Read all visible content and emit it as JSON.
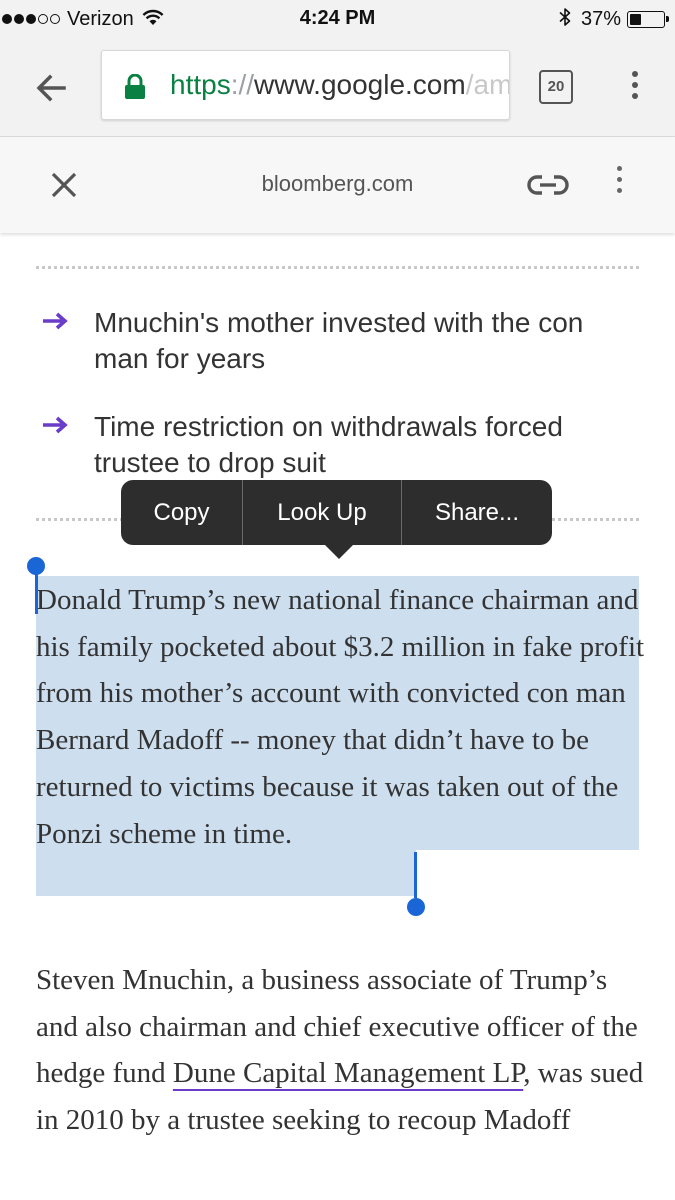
{
  "status_bar": {
    "signal_filled": 3,
    "signal_total": 5,
    "carrier": "Verizon",
    "time": "4:24 PM",
    "battery_percent": "37%",
    "battery_level": 0.37
  },
  "browser": {
    "url_scheme": "https",
    "url_separator": "://",
    "url_host": "www.google.com",
    "url_rest": "/amp",
    "tab_count": "20",
    "accent_secure": "#0b8043"
  },
  "custom_tab": {
    "domain": "bloomberg.com"
  },
  "article": {
    "bullets": [
      "Mnuchin's mother invested with the con man for years",
      "Time restriction on withdrawals forced trustee to drop suit"
    ],
    "selected_paragraph": "Donald Trump’s new national finance chairman and his family pocketed about $3.2 million in fake profit from his mother’s account with convicted con man Bernard Madoff -- money that didn’t have to be returned to victims because it was taken out of the Ponzi scheme in time.",
    "paragraph2_before_link": "Steven Mnuchin, a business associate of Trump’s and also chairman and chief executive officer of the hedge fund ",
    "paragraph2_link": "Dune Capital Management LP",
    "paragraph2_after_link": ", was sued in 2010 by a trustee seeking to recoup Madoff",
    "accent_color": "#6a3cc9",
    "selection_color": "#cddeef"
  },
  "callout_menu": {
    "items": [
      "Copy",
      "Look Up",
      "Share..."
    ]
  }
}
